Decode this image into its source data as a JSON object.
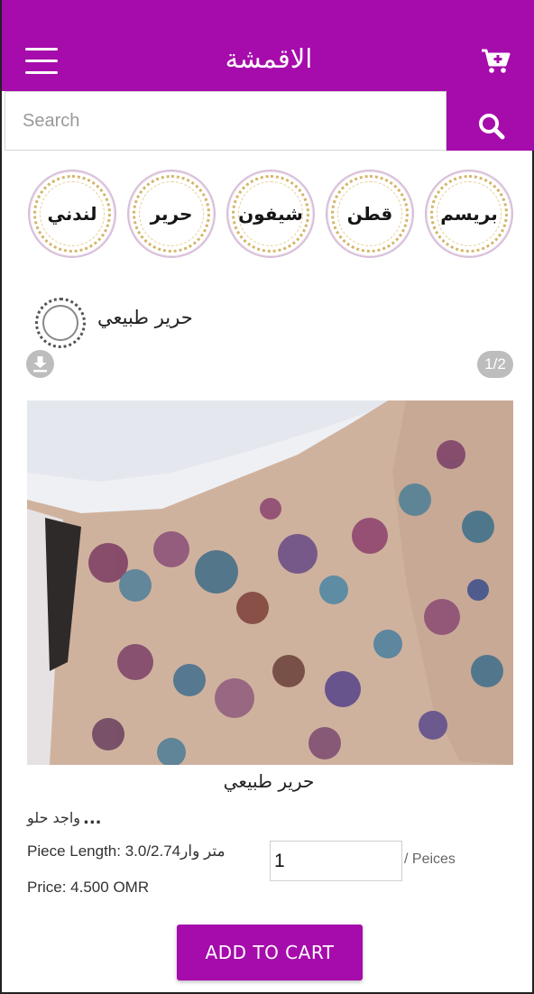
{
  "header": {
    "title": "الاقمشة",
    "menu_icon": "hamburger-menu-icon",
    "cart_icon": "cart-plus-icon",
    "brand_color": "#a60bab"
  },
  "search": {
    "placeholder": "Search",
    "value": "",
    "button_icon": "search-icon"
  },
  "categories": [
    {
      "label": "بريسم"
    },
    {
      "label": "قطن"
    },
    {
      "label": "شيفون"
    },
    {
      "label": "حرير"
    },
    {
      "label": "لندني"
    }
  ],
  "shop": {
    "name": "حرير طبيعي"
  },
  "gallery": {
    "download_icon": "download-icon",
    "page_indicator": "1/2",
    "image": "floral silk fabric photo"
  },
  "product": {
    "title": "حرير طبيعي",
    "description": "واجد حلو",
    "more": "...",
    "piece_length": "Piece Length: 3.0/2.74متر وار",
    "quantity": "1",
    "quantity_unit": "/ Peices",
    "price": "Price: 4.500 OMR"
  },
  "actions": {
    "add_to_cart": "ADD TO CART"
  }
}
